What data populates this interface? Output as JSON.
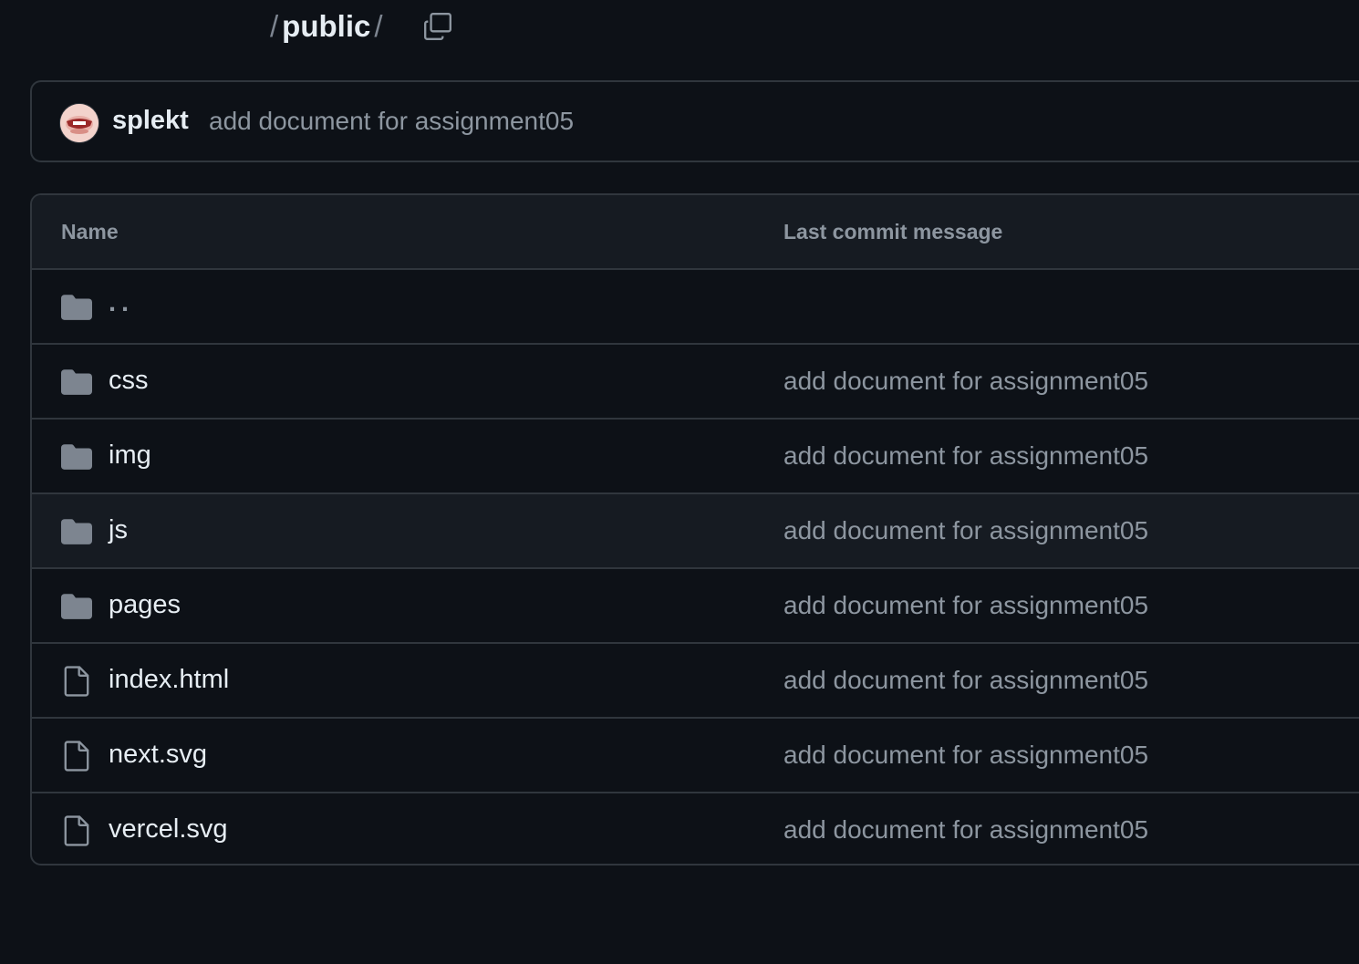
{
  "breadcrumb": {
    "separator": "/",
    "current": "public",
    "trailing_separator": "/"
  },
  "copy_button": {
    "icon": "copy-icon"
  },
  "latest_commit": {
    "author": "splekt",
    "message": "add document for assignment05"
  },
  "table": {
    "headers": {
      "name": "Name",
      "message": "Last commit message"
    },
    "rows": [
      {
        "type": "folder",
        "name": "..",
        "message": ""
      },
      {
        "type": "folder",
        "name": "css",
        "message": "add document for assignment05"
      },
      {
        "type": "folder",
        "name": "img",
        "message": "add document for assignment05"
      },
      {
        "type": "folder",
        "name": "js",
        "message": "add document for assignment05"
      },
      {
        "type": "folder",
        "name": "pages",
        "message": "add document for assignment05"
      },
      {
        "type": "file",
        "name": "index.html",
        "message": "add document for assignment05"
      },
      {
        "type": "file",
        "name": "next.svg",
        "message": "add document for assignment05"
      },
      {
        "type": "file",
        "name": "vercel.svg",
        "message": "add document for assignment05"
      }
    ]
  },
  "colors": {
    "background": "#0d1117",
    "header_bg": "#161b22",
    "border": "#30363d",
    "text_primary": "#e6edf3",
    "text_muted": "#8d96a0",
    "folder_icon": "#7d8590"
  }
}
